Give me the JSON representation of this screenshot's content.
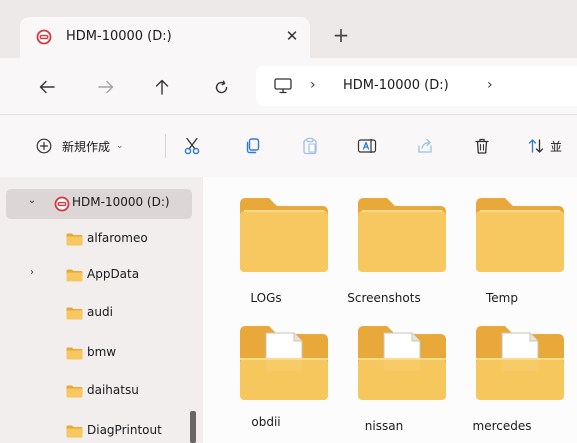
{
  "window": {
    "tab_title": "HDM-10000 (D:)",
    "close_glyph": "✕",
    "new_tab_glyph": "+"
  },
  "nav": {
    "back_glyph": "←",
    "forward_glyph": "→",
    "up_glyph": "↑",
    "refresh_glyph": "↻",
    "address_separator": "›",
    "address_text": "HDM-10000 (D:)"
  },
  "toolbar": {
    "new_label": "新規作成",
    "new_caret": "⌄",
    "sort_label": "並"
  },
  "sidebar": {
    "items": [
      {
        "label": "HDM-10000 (D:)",
        "chevron": "⌄",
        "type": "drive"
      },
      {
        "label": "alfaromeo",
        "chevron": "",
        "type": "folder"
      },
      {
        "label": "AppData",
        "chevron": "›",
        "type": "folder"
      },
      {
        "label": "audi",
        "chevron": "",
        "type": "folder"
      },
      {
        "label": "bmw",
        "chevron": "",
        "type": "folder"
      },
      {
        "label": "daihatsu",
        "chevron": "",
        "type": "folder"
      },
      {
        "label": "DiagPrintout",
        "chevron": "",
        "type": "folder"
      }
    ]
  },
  "content": {
    "folders": [
      {
        "label": "LOGs",
        "kind": "empty"
      },
      {
        "label": "Screenshots",
        "kind": "empty"
      },
      {
        "label": "Temp",
        "kind": "empty"
      },
      {
        "label": "obdii",
        "kind": "files"
      },
      {
        "label": "nissan",
        "kind": "files"
      },
      {
        "label": "mercedes",
        "kind": "files"
      }
    ]
  },
  "colors": {
    "folder_front": "#f7c85f",
    "folder_back": "#e8a93a",
    "drive_accent": "#d8343c",
    "selection": "#dcd6d6"
  }
}
